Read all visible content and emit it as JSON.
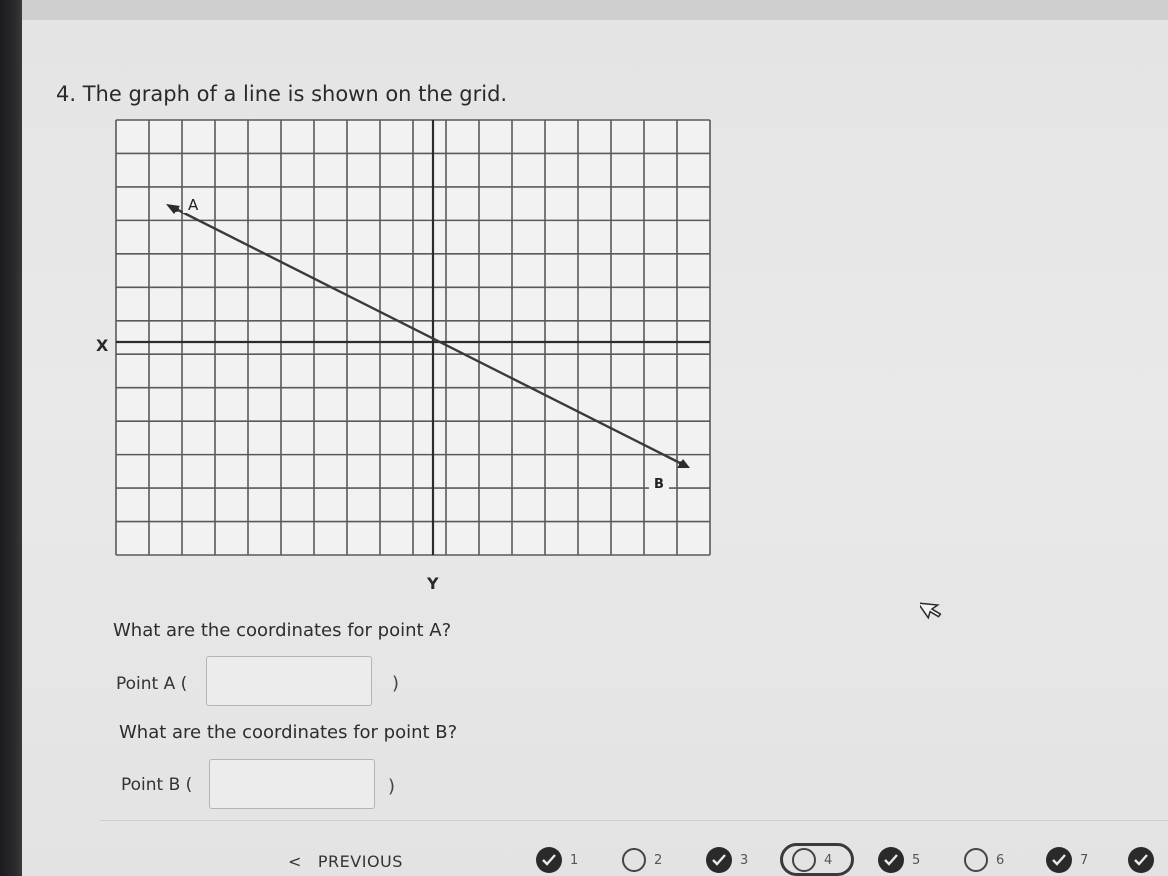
{
  "question": {
    "text": "4. The graph of a line is shown on the grid."
  },
  "graph": {
    "x_axis_label": "X",
    "y_axis_label": "Y",
    "point_a_label": "A",
    "point_b_label": "B"
  },
  "prompts": {
    "point_a_question": "What are the coordinates for point A?",
    "point_b_question": "What are the coordinates for point B?"
  },
  "answers": {
    "point_a_label": "Point A (",
    "point_a_value": "",
    "point_b_label": "Point B (",
    "point_b_value": "",
    "close_paren": ")"
  },
  "navigation": {
    "previous_label": "PREVIOUS",
    "previous_chevron": "<",
    "questions": [
      {
        "number": "1",
        "status": "answered"
      },
      {
        "number": "2",
        "status": "unanswered"
      },
      {
        "number": "3",
        "status": "answered"
      },
      {
        "number": "4",
        "status": "current"
      },
      {
        "number": "5",
        "status": "answered"
      },
      {
        "number": "6",
        "status": "unanswered"
      },
      {
        "number": "7",
        "status": "answered"
      }
    ]
  }
}
